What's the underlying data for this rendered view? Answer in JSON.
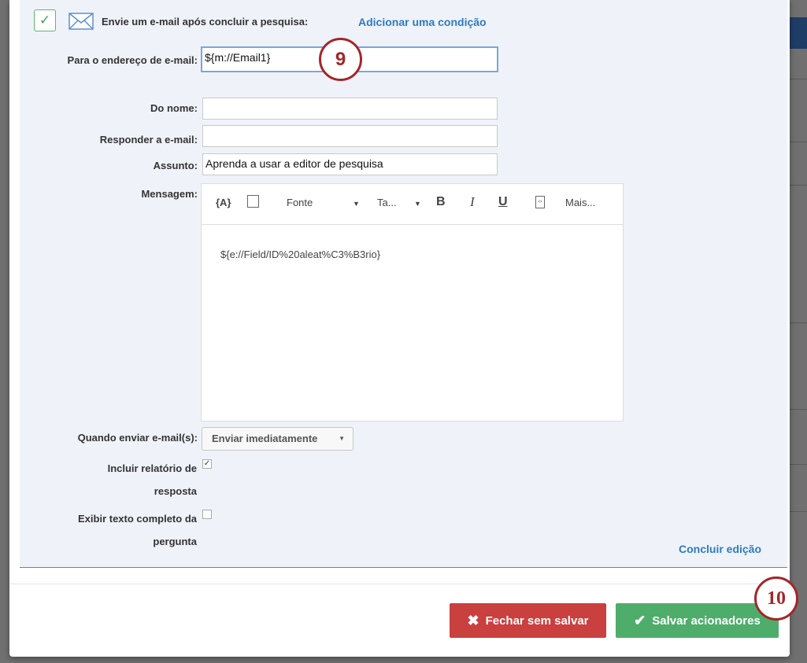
{
  "trigger": {
    "enabled": true,
    "title": "Envie um e-mail após concluir a pesquisa:",
    "add_condition": "Adicionar uma condição"
  },
  "form": {
    "to_label": "Para o endereço de e-mail:",
    "to_value": "${m://Email1}",
    "from_name_label": "Do nome:",
    "from_name_value": "",
    "reply_to_label": "Responder a e-mail:",
    "reply_to_value": "",
    "subject_label": "Assunto:",
    "subject_value": "Aprenda a usar a  editor de pesquisa",
    "message_label": "Mensagem:",
    "message_body": "${e://Field/ID%20aleat%C3%B3rio}",
    "when_label": "Quando enviar e-mail(s):",
    "when_value": "Enviar imediatamente",
    "include_report_label": "Incluir relatório de resposta",
    "include_report_checked": true,
    "full_text_label": "Exibir texto completo da pergunta",
    "full_text_checked": false,
    "finish_edit": "Concluir edição"
  },
  "toolbar": {
    "piped": "{A}",
    "font": "Fonte",
    "size": "Ta...",
    "bold": "B",
    "italic": "I",
    "underline": "U",
    "more": "Mais..."
  },
  "footer": {
    "close_label": "Fechar sem salvar",
    "save_label": "Salvar acionadores"
  },
  "callouts": {
    "step9": "9",
    "step10": "10"
  },
  "colors": {
    "close": "#c9403f",
    "save": "#4fad6b",
    "link": "#2e7ac4"
  }
}
